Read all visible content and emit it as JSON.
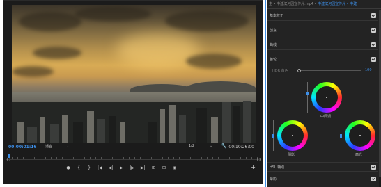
{
  "monitor": {
    "current_time": "00:00:01:16",
    "total_time": "00:10:26:00",
    "fit_label": "适合",
    "resolution_label": "1/2",
    "transport": [
      "●",
      "{",
      "}",
      "|◀",
      "◀|",
      "▶",
      "|▶",
      "▶|",
      "⊞",
      "⊟",
      "◉"
    ],
    "add_label": "+"
  },
  "panel": {
    "tabs": {
      "main": "主 • 中建滨河园宣传片.mp4",
      "sep": " • ",
      "active": "中建滨河园宣传片 • 中建"
    },
    "sections": {
      "basic": "基本校正",
      "creative": "创意",
      "curves": "曲线",
      "wheels": "色轮",
      "hsl": "HSL 辅助",
      "vignette": "晕影"
    },
    "saturation": {
      "label": "HDR 白色",
      "value": "100"
    },
    "wheels": {
      "midtones": "中间调",
      "shadows": "阴影",
      "highlights": "高光"
    }
  },
  "colors": {
    "accent": "#3d8fe8",
    "panel_bg": "#232323",
    "monitor_bg": "#1b1b1b"
  }
}
